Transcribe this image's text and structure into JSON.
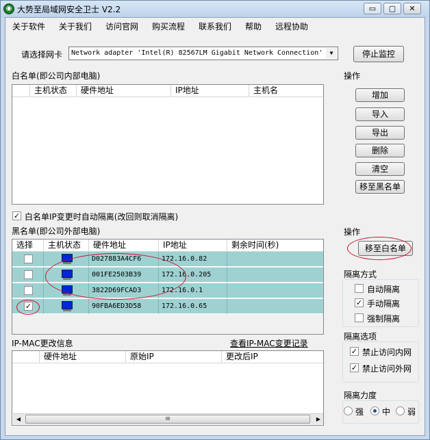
{
  "window": {
    "title": "大势至局域网安全卫士 V2.2",
    "minimize": "▭",
    "restore": "▢",
    "close": "✕"
  },
  "menu": [
    "关于软件",
    "关于我们",
    "访问官网",
    "购买流程",
    "联系我们",
    "帮助",
    "远程协助"
  ],
  "adapter": {
    "label": "请选择网卡",
    "value": "Network adapter 'Intel(R) 82567LM Gigabit Network Connection'",
    "stop_button": "停止监控"
  },
  "whitelist": {
    "title": "白名单(即公司内部电脑)",
    "columns": [
      "主机状态",
      "硬件地址",
      "IP地址",
      "主机名"
    ],
    "actions_title": "操作",
    "actions": [
      "增加",
      "导入",
      "导出",
      "删除",
      "清空",
      "移至黑名单"
    ],
    "auto_isolate": {
      "checked": true,
      "label": "白名单IP变更时自动隔离(改回则取消隔离)"
    }
  },
  "blacklist": {
    "title": "黑名单(即公司外部电脑)",
    "columns": [
      "选择",
      "主机状态",
      "硬件地址",
      "IP地址",
      "剩余时间(秒)"
    ],
    "rows": [
      {
        "checked": false,
        "mac": "D027883A4CF6",
        "ip": "172.16.0.82",
        "remaining": ""
      },
      {
        "checked": false,
        "mac": "001FE2503B39",
        "ip": "172.16.0.205",
        "remaining": ""
      },
      {
        "checked": false,
        "mac": "3822D69FCAD3",
        "ip": "172.16.0.1",
        "remaining": ""
      },
      {
        "checked": true,
        "mac": "90FBA6ED3D58",
        "ip": "172.16.0.65",
        "remaining": ""
      }
    ],
    "actions_title": "操作",
    "move_to_whitelist": "移至白名单"
  },
  "isolation_mode": {
    "title": "隔离方式",
    "options": [
      {
        "label": "自动隔离",
        "checked": false
      },
      {
        "label": "手动隔离",
        "checked": true
      },
      {
        "label": "强制隔离",
        "checked": false
      }
    ]
  },
  "isolation_options": {
    "title": "隔离选项",
    "options": [
      {
        "label": "禁止访问内网",
        "checked": true
      },
      {
        "label": "禁止访问外网",
        "checked": true
      }
    ]
  },
  "isolation_strength": {
    "title": "隔离力度",
    "options": [
      {
        "label": "强",
        "selected": false
      },
      {
        "label": "中",
        "selected": true
      },
      {
        "label": "弱",
        "selected": false
      }
    ]
  },
  "ipmac": {
    "title": "IP-MAC更改信息",
    "view_log": "查看IP-MAC变更记录",
    "columns": [
      "硬件地址",
      "原始IP",
      "更改后IP"
    ],
    "scroll_thumb": "III"
  },
  "colors": {
    "accent_red": "#c8102e",
    "row_teal": "#9fd1d1"
  }
}
